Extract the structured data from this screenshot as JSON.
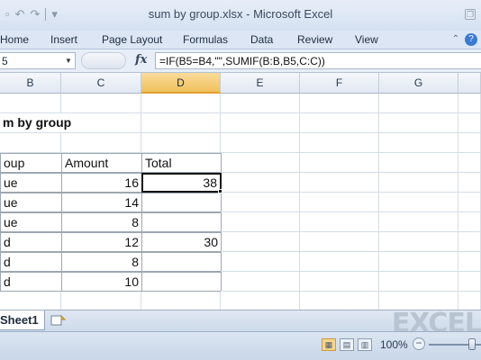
{
  "window": {
    "title": "sum by group.xlsx - Microsoft Excel",
    "restore_glyph": "❐"
  },
  "quick_access": {
    "save_icon": "▫",
    "undo_icon": "↶",
    "redo_icon": "↷",
    "customize_icon": "▾"
  },
  "ribbon": {
    "tabs": [
      "Home",
      "Insert",
      "Page Layout",
      "Formulas",
      "Data",
      "Review",
      "View"
    ],
    "minimize_glyph": "⌃",
    "help_glyph": "?"
  },
  "formula_bar": {
    "name_box": "5",
    "fx_label": "fx",
    "formula": "=IF(B5=B4,\"\",SUMIF(B:B,B5,C:C))"
  },
  "columns": [
    "B",
    "C",
    "D",
    "E",
    "F",
    "G"
  ],
  "selected_column": "D",
  "sheet": {
    "title": "m by group",
    "headers": [
      "oup",
      "Amount",
      "Total"
    ],
    "rows": [
      {
        "group": "ue",
        "amount": "16",
        "total": "38"
      },
      {
        "group": "ue",
        "amount": "14",
        "total": ""
      },
      {
        "group": "ue",
        "amount": "8",
        "total": ""
      },
      {
        "group": "d",
        "amount": "12",
        "total": "30"
      },
      {
        "group": "d",
        "amount": "8",
        "total": ""
      },
      {
        "group": "d",
        "amount": "10",
        "total": ""
      }
    ]
  },
  "sheet_tabs": {
    "active": "Sheet1",
    "watermark": "EXCEL"
  },
  "status_bar": {
    "zoom": "100%",
    "zoom_level": 100
  }
}
